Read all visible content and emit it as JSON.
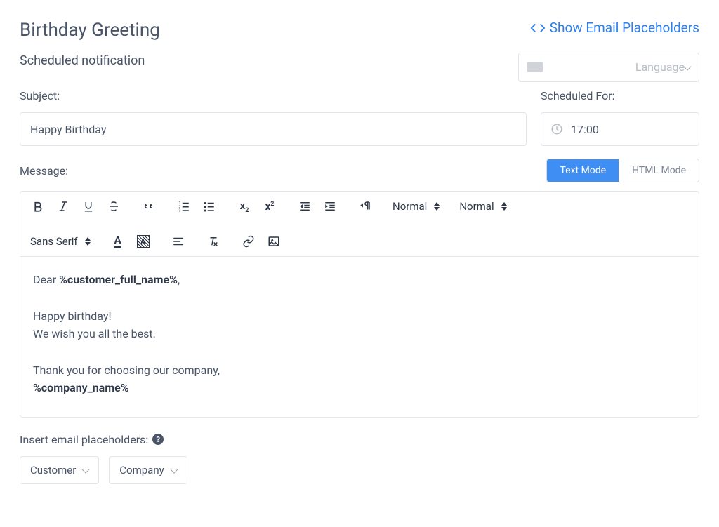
{
  "header": {
    "title": "Birthday Greeting",
    "subtitle": "Scheduled notification",
    "placeholders_link": "Show Email Placeholders",
    "language_placeholder": "Language"
  },
  "fields": {
    "subject_label": "Subject:",
    "subject_value": "Happy Birthday",
    "scheduled_label": "Scheduled For:",
    "scheduled_value": "17:00",
    "message_label": "Message:"
  },
  "modes": {
    "text": "Text Mode",
    "html": "HTML Mode"
  },
  "toolbar": {
    "font_family": "Sans Serif",
    "size_label": "Normal",
    "header_label": "Normal"
  },
  "message": {
    "line1_pre": "Dear ",
    "line1_ph": "%customer_full_name%",
    "line1_post": ",",
    "line2": "Happy birthday!",
    "line3": "We wish you all the best.",
    "line4": "Thank you for choosing our company,",
    "line5_ph": "%company_name%"
  },
  "insert": {
    "label": "Insert email placeholders:",
    "customer": "Customer",
    "company": "Company"
  }
}
